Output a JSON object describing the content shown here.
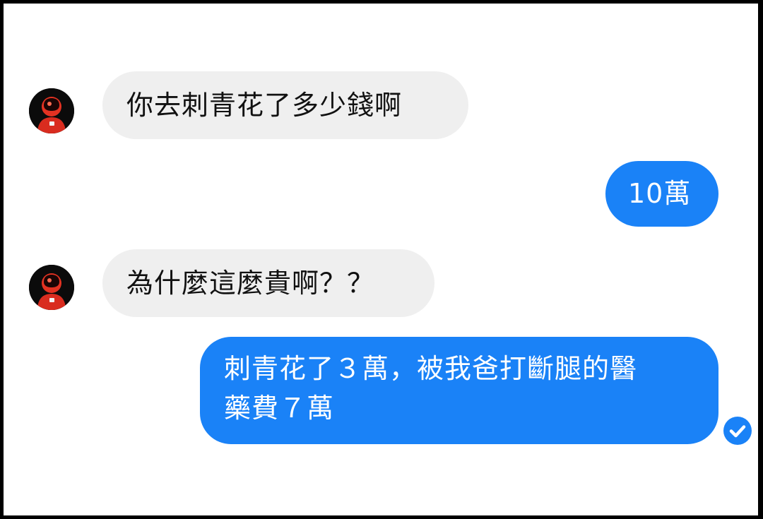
{
  "conversation": {
    "messages": [
      {
        "sender": "other",
        "text": "你去刺青花了多少錢啊"
      },
      {
        "sender": "me",
        "text": "10萬"
      },
      {
        "sender": "other",
        "text": "為什麼這麼貴啊？？"
      },
      {
        "sender": "me",
        "lines": [
          "刺青花了３萬，被我爸打斷腿的醫",
          "藥費７萬"
        ]
      }
    ],
    "read_receipt_icon": "check-circle-icon",
    "avatar_icon": "astronaut-avatar"
  },
  "colors": {
    "outgoing_bubble": "#1a82f7",
    "incoming_bubble": "#efefef",
    "avatar_accent": "#e33222"
  }
}
